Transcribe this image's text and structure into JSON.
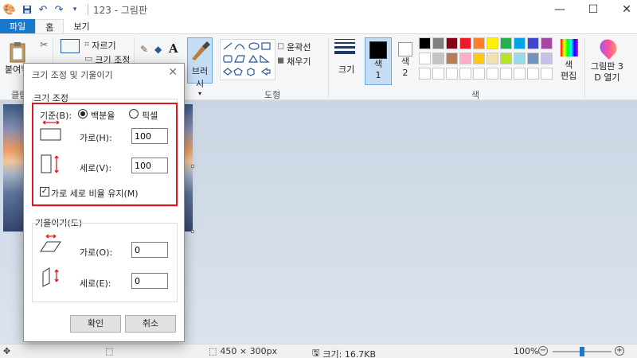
{
  "titlebar": {
    "title": "123 - 그림판",
    "minimize": "—",
    "maximize": "☐",
    "close": "✕"
  },
  "tabs": [
    {
      "label": "파일"
    },
    {
      "label": "홈"
    },
    {
      "label": "보기"
    }
  ],
  "ribbon": {
    "paste_label": "붙여넣",
    "clipboard_group": "클립",
    "crop_label": "자르기",
    "resize_label": "크기 조정",
    "brush_label": "브러시",
    "outline_label": "윤곽선",
    "fill_label": "채우기",
    "shapes_group": "도형",
    "size_label": "크기",
    "color1_label": "색\n1",
    "color2_label": "색\n2",
    "colors_group": "색",
    "edit_colors_label": "색\n편집",
    "paint3d_label": "그림판 3\nD 열기"
  },
  "palette": {
    "row1": [
      "#000000",
      "#7f7f7f",
      "#880015",
      "#ed1c24",
      "#ff7f27",
      "#fff200",
      "#22b14c",
      "#00a2e8",
      "#3f48cc",
      "#a349a4"
    ],
    "row2": [
      "#ffffff",
      "#c3c3c3",
      "#b97a57",
      "#ffaec9",
      "#ffc90e",
      "#efe4b0",
      "#b5e61d",
      "#99d9ea",
      "#7092be",
      "#c8bfe7"
    ],
    "color1": "#000000",
    "color2": "#ffffff"
  },
  "dialog": {
    "title": "크기 조정 및 기울이기",
    "close": "✕",
    "resize_section": "크기 조정",
    "basis_label": "기준(B):",
    "percent_label": "백분율",
    "pixel_label": "픽셀",
    "horizontal_label": "가로(H):",
    "horizontal_value": "100",
    "vertical_label": "세로(V):",
    "vertical_value": "100",
    "keep_ratio_label": "가로 세로 비율 유지(M)",
    "keep_ratio_checked": true,
    "skew_section": "기울이기(도)",
    "skew_h_label": "가로(O):",
    "skew_h_value": "0",
    "skew_v_label": "세로(E):",
    "skew_v_value": "0",
    "ok_label": "확인",
    "cancel_label": "취소"
  },
  "statusbar": {
    "dimensions": "450 × 300px",
    "file_size": "크기: 16.7KB",
    "zoom": "100%",
    "zoom_out": "−",
    "zoom_in": "+",
    "zoom_level_fraction": 0.5
  }
}
